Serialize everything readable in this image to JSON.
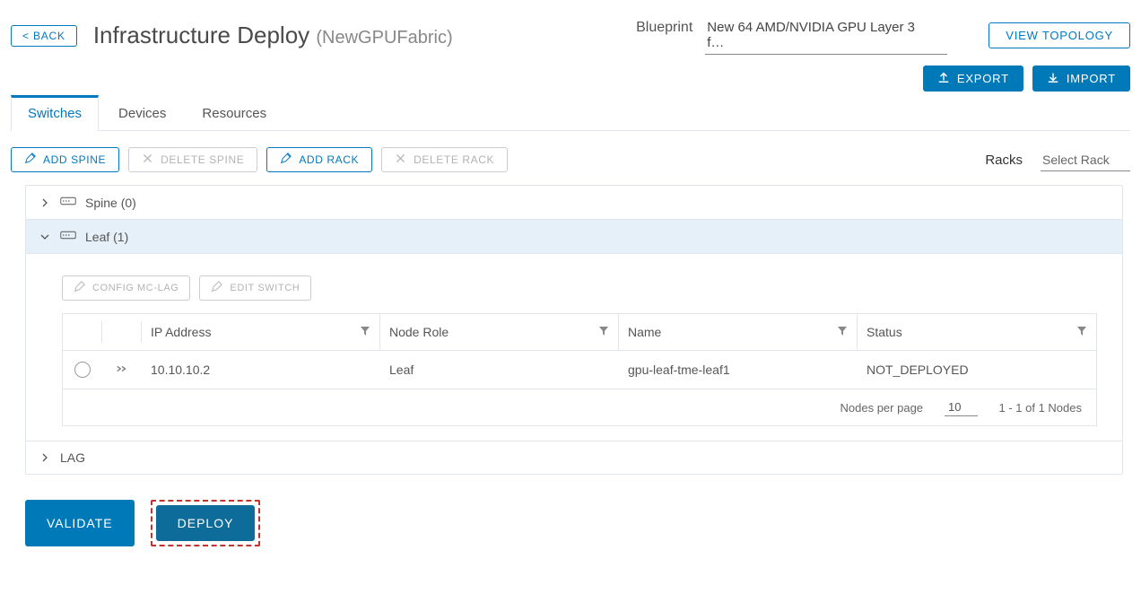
{
  "header": {
    "back_label": "< BACK",
    "title": "Infrastructure Deploy",
    "title_paren": "(NewGPUFabric)",
    "blueprint_label": "Blueprint",
    "blueprint_value": "New 64 AMD/NVIDIA GPU Layer 3 f…",
    "view_topology": "VIEW TOPOLOGY"
  },
  "actions": {
    "export": "EXPORT",
    "import": "IMPORT"
  },
  "tabs": [
    {
      "label": "Switches",
      "active": true
    },
    {
      "label": "Devices",
      "active": false
    },
    {
      "label": "Resources",
      "active": false
    }
  ],
  "toolbar": {
    "add_spine": "ADD SPINE",
    "delete_spine": "DELETE SPINE",
    "add_rack": "ADD RACK",
    "delete_rack": "DELETE RACK",
    "racks_label": "Racks",
    "racks_value": "Select Rack"
  },
  "accordion": {
    "spine_label": "Spine (0)",
    "leaf_label": "Leaf (1)",
    "lag_label": "LAG"
  },
  "leaf_actions": {
    "config": "CONFIG MC-LAG",
    "edit": "EDIT SWITCH"
  },
  "table": {
    "headers": {
      "ip": "IP Address",
      "role": "Node Role",
      "name": "Name",
      "status": "Status"
    },
    "rows": [
      {
        "ip": "10.10.10.2",
        "role": "Leaf",
        "name": "gpu-leaf-tme-leaf1",
        "status": "NOT_DEPLOYED"
      }
    ],
    "footer": {
      "per_page_label": "Nodes per page",
      "per_page_value": "10",
      "range": "1 - 1 of 1 Nodes"
    }
  },
  "footer": {
    "validate": "VALIDATE",
    "deploy": "DEPLOY"
  }
}
